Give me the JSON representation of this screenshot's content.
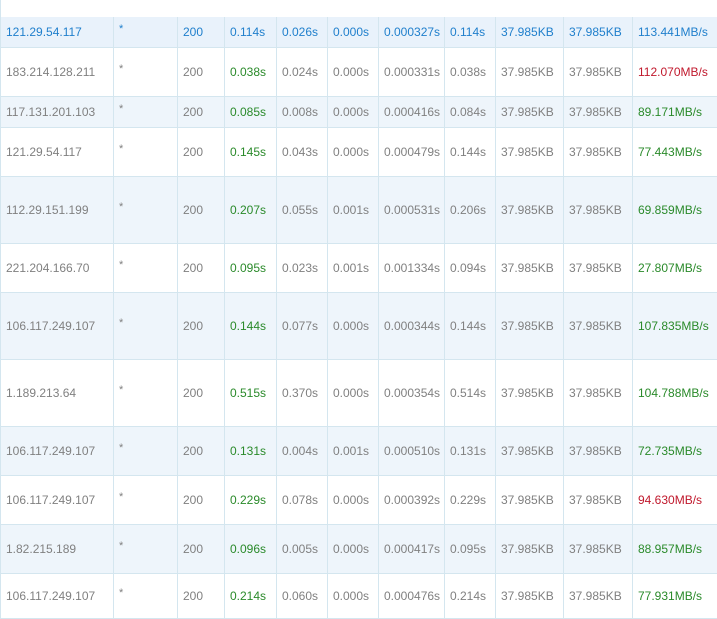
{
  "colors": {
    "highlight_text": "#1f7fcc",
    "fast_time": "#2a8a2a",
    "speed_good": "#2a8a2a",
    "speed_warn": "#c0182c",
    "text": "#808080",
    "grid_line": "#d4e6ef",
    "alt_row": "#eef5fb"
  },
  "rows": [
    {
      "ip": "121.29.54.117",
      "host": "*",
      "status": "200",
      "total": "0.114s",
      "connect": "0.026s",
      "dns": "0.000s",
      "first": "0.000327s",
      "download": "0.114s",
      "size": "37.985KB",
      "fsize": "37.985KB",
      "speed": "113.441MB/s",
      "highlight": true,
      "speed_tone": "green"
    },
    {
      "ip": "183.214.128.211",
      "host": "*",
      "status": "200",
      "total": "0.038s",
      "connect": "0.024s",
      "dns": "0.000s",
      "first": "0.000331s",
      "download": "0.038s",
      "size": "37.985KB",
      "fsize": "37.985KB",
      "speed": "112.070MB/s",
      "highlight": false,
      "speed_tone": "red"
    },
    {
      "ip": "117.131.201.103",
      "host": "*",
      "status": "200",
      "total": "0.085s",
      "connect": "0.008s",
      "dns": "0.000s",
      "first": "0.000416s",
      "download": "0.084s",
      "size": "37.985KB",
      "fsize": "37.985KB",
      "speed": "89.171MB/s",
      "highlight": false,
      "speed_tone": "green"
    },
    {
      "ip": "121.29.54.117",
      "host": "*",
      "status": "200",
      "total": "0.145s",
      "connect": "0.043s",
      "dns": "0.000s",
      "first": "0.000479s",
      "download": "0.144s",
      "size": "37.985KB",
      "fsize": "37.985KB",
      "speed": "77.443MB/s",
      "highlight": false,
      "speed_tone": "green"
    },
    {
      "ip": "112.29.151.199",
      "host": "*",
      "status": "200",
      "total": "0.207s",
      "connect": "0.055s",
      "dns": "0.001s",
      "first": "0.000531s",
      "download": "0.206s",
      "size": "37.985KB",
      "fsize": "37.985KB",
      "speed": "69.859MB/s",
      "highlight": false,
      "speed_tone": "green"
    },
    {
      "ip": "221.204.166.70",
      "host": "*",
      "status": "200",
      "total": "0.095s",
      "connect": "0.023s",
      "dns": "0.001s",
      "first": "0.001334s",
      "download": "0.094s",
      "size": "37.985KB",
      "fsize": "37.985KB",
      "speed": "27.807MB/s",
      "highlight": false,
      "speed_tone": "green"
    },
    {
      "ip": "106.117.249.107",
      "host": "*",
      "status": "200",
      "total": "0.144s",
      "connect": "0.077s",
      "dns": "0.000s",
      "first": "0.000344s",
      "download": "0.144s",
      "size": "37.985KB",
      "fsize": "37.985KB",
      "speed": "107.835MB/s",
      "highlight": false,
      "speed_tone": "green"
    },
    {
      "ip": "1.189.213.64",
      "host": "*",
      "status": "200",
      "total": "0.515s",
      "connect": "0.370s",
      "dns": "0.000s",
      "first": "0.000354s",
      "download": "0.514s",
      "size": "37.985KB",
      "fsize": "37.985KB",
      "speed": "104.788MB/s",
      "highlight": false,
      "speed_tone": "green"
    },
    {
      "ip": "106.117.249.107",
      "host": "*",
      "status": "200",
      "total": "0.131s",
      "connect": "0.004s",
      "dns": "0.001s",
      "first": "0.000510s",
      "download": "0.131s",
      "size": "37.985KB",
      "fsize": "37.985KB",
      "speed": "72.735MB/s",
      "highlight": false,
      "speed_tone": "green"
    },
    {
      "ip": "106.117.249.107",
      "host": "*",
      "status": "200",
      "total": "0.229s",
      "connect": "0.078s",
      "dns": "0.000s",
      "first": "0.000392s",
      "download": "0.229s",
      "size": "37.985KB",
      "fsize": "37.985KB",
      "speed": "94.630MB/s",
      "highlight": false,
      "speed_tone": "red"
    },
    {
      "ip": "1.82.215.189",
      "host": "*",
      "status": "200",
      "total": "0.096s",
      "connect": "0.005s",
      "dns": "0.000s",
      "first": "0.000417s",
      "download": "0.095s",
      "size": "37.985KB",
      "fsize": "37.985KB",
      "speed": "88.957MB/s",
      "highlight": false,
      "speed_tone": "green"
    },
    {
      "ip": "106.117.249.107",
      "host": "*",
      "status": "200",
      "total": "0.214s",
      "connect": "0.060s",
      "dns": "0.000s",
      "first": "0.000476s",
      "download": "0.214s",
      "size": "37.985KB",
      "fsize": "37.985KB",
      "speed": "77.931MB/s",
      "highlight": false,
      "speed_tone": "green"
    }
  ]
}
